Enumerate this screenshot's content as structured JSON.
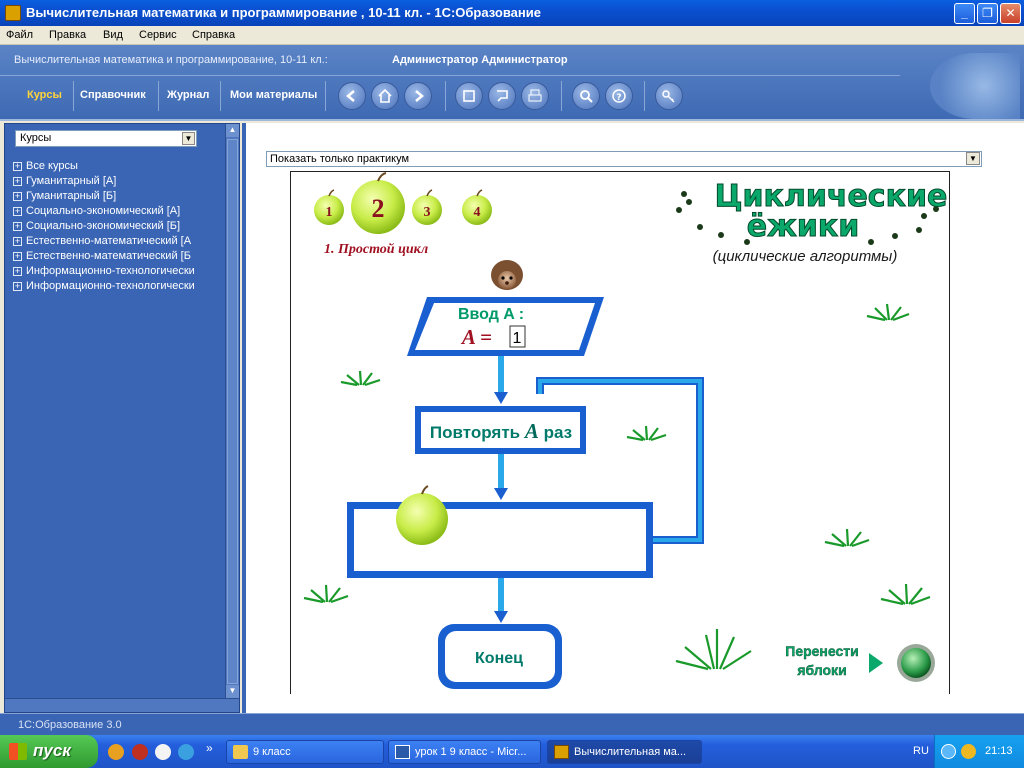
{
  "window": {
    "title": "Вычислительная математика и программирование , 10-11 кл.  - 1С:Образование",
    "minimize_glyph": "_",
    "maximize_glyph": "❐",
    "close_glyph": "✕"
  },
  "menu": [
    "Файл",
    "Правка",
    "Вид",
    "Сервис",
    "Справка"
  ],
  "header": {
    "course": "Вычислительная математика и программирование, 10-11 кл.:",
    "user": "Администратор Администратор",
    "tabs": [
      "Курсы",
      "Справочник",
      "Журнал",
      "Мои материалы"
    ],
    "active_tab": "Курсы",
    "tool_icons": [
      "back-arrow-icon",
      "home-icon",
      "forward-arrow-icon",
      "fullscreen-icon",
      "pointer-icon",
      "print-icon",
      "search-icon",
      "help-icon",
      "key-icon"
    ]
  },
  "sidebar": {
    "select_value": "Курсы",
    "items": [
      "Все курсы",
      "Гуманитарный [А]",
      "Гуманитарный [Б]",
      "Социально-экономический [А]",
      "Социально-экономический [Б]",
      "Естественно-математический [А",
      "Естественно-математический [Б",
      "Информационно-технологически",
      "Информационно-технологически"
    ]
  },
  "content": {
    "filter_value": "Показать только практикум",
    "lesson": {
      "steps": [
        "1",
        "2",
        "3",
        "4"
      ],
      "active_step": "2",
      "step_title": "1. Простой цикл",
      "title_line1": "Циклические",
      "title_line2": "ёжики",
      "subtitle": "(циклические алгоритмы)",
      "input_label": "Ввод  A :",
      "input_expr": "A = ",
      "input_value": "1",
      "loop_label_pre": "Повторять ",
      "loop_label_var": "A",
      "loop_label_post": " раз",
      "end_label": "Конец",
      "action_line1": "Перенести",
      "action_line2": "яблоки"
    }
  },
  "status": {
    "text": "1С:Образование 3.0"
  },
  "taskbar": {
    "start_label": "пуск",
    "tasks": [
      "9  класс",
      "урок 1 9 класс - Micr...",
      "Вычислительная ма..."
    ],
    "active_task": 2,
    "lang": "RU",
    "time": "21:13",
    "chevron": "»"
  },
  "colors": {
    "header_blue": "#3e6ab4",
    "flow_blue": "#1a5fd0",
    "flow_green": "#009a6a",
    "apple_green": "#c8ec48",
    "title_red": "#a01020"
  }
}
